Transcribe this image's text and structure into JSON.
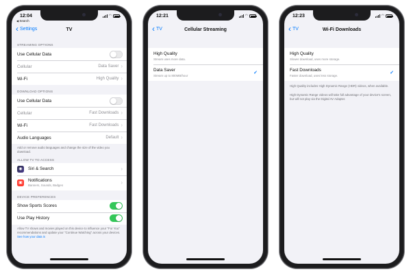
{
  "colors": {
    "accent": "#007aff",
    "toggle_on": "#34c759",
    "notif_icon_bg": "#ff3b30"
  },
  "screen1": {
    "status": {
      "time": "12:04",
      "back_app": "Search"
    },
    "nav": {
      "back": "Settings",
      "title": "TV"
    },
    "streaming": {
      "header": "STREAMING OPTIONS",
      "use_cellular": "Use Cellular Data",
      "cellular_label": "Cellular",
      "cellular_value": "Data Saver",
      "wifi_label": "Wi-Fi",
      "wifi_value": "High Quality"
    },
    "download": {
      "header": "DOWNLOAD OPTIONS",
      "use_cellular": "Use Cellular Data",
      "cellular_label": "Cellular",
      "cellular_value": "Fast Downloads",
      "wifi_label": "Wi-Fi",
      "wifi_value": "Fast Downloads",
      "audio_label": "Audio Languages",
      "audio_value": "Default",
      "footer": "Add or remove audio languages and change the size of the video you download."
    },
    "access": {
      "header": "ALLOW TV TO ACCESS",
      "siri": "Siri & Search",
      "notifications": "Notifications",
      "notifications_sub": "Banners, Sounds, Badges"
    },
    "preferences": {
      "header": "DEVICE PREFERENCES",
      "sports": "Show Sports Scores",
      "history": "Use Play History",
      "footer": "Allow TV shows and movies played on this device to influence your \"For You\" recommendations and update your \"Continue Watching\" across your devices.",
      "footer_link": "See how your data is"
    },
    "toggles": {
      "stream_cellular": false,
      "download_cellular": false,
      "sports": true,
      "history": true
    }
  },
  "screen2": {
    "status": {
      "time": "12:21"
    },
    "nav": {
      "back": "TV",
      "title": "Cellular Streaming"
    },
    "options": [
      {
        "title": "High Quality",
        "sub": "Stream uses more data.",
        "checked": false
      },
      {
        "title": "Data Saver",
        "sub": "Stream up to 800MB/hour",
        "checked": true
      }
    ],
    "check_glyph": "✓"
  },
  "screen3": {
    "status": {
      "time": "12:23"
    },
    "nav": {
      "back": "TV",
      "title": "Wi-Fi Downloads"
    },
    "options": [
      {
        "title": "High Quality",
        "sub": "Slower download, uses more storage.",
        "checked": false
      },
      {
        "title": "Fast Downloads",
        "sub": "Faster download, uses less storage.",
        "checked": true
      }
    ],
    "check_glyph": "✓",
    "note1": "High Quality includes High Dynamic Range (HDR) videos, when available.",
    "note2": "High Dynamic Range videos will take full advantage of your device's screen, but will not play via the Digital AV Adapter."
  }
}
